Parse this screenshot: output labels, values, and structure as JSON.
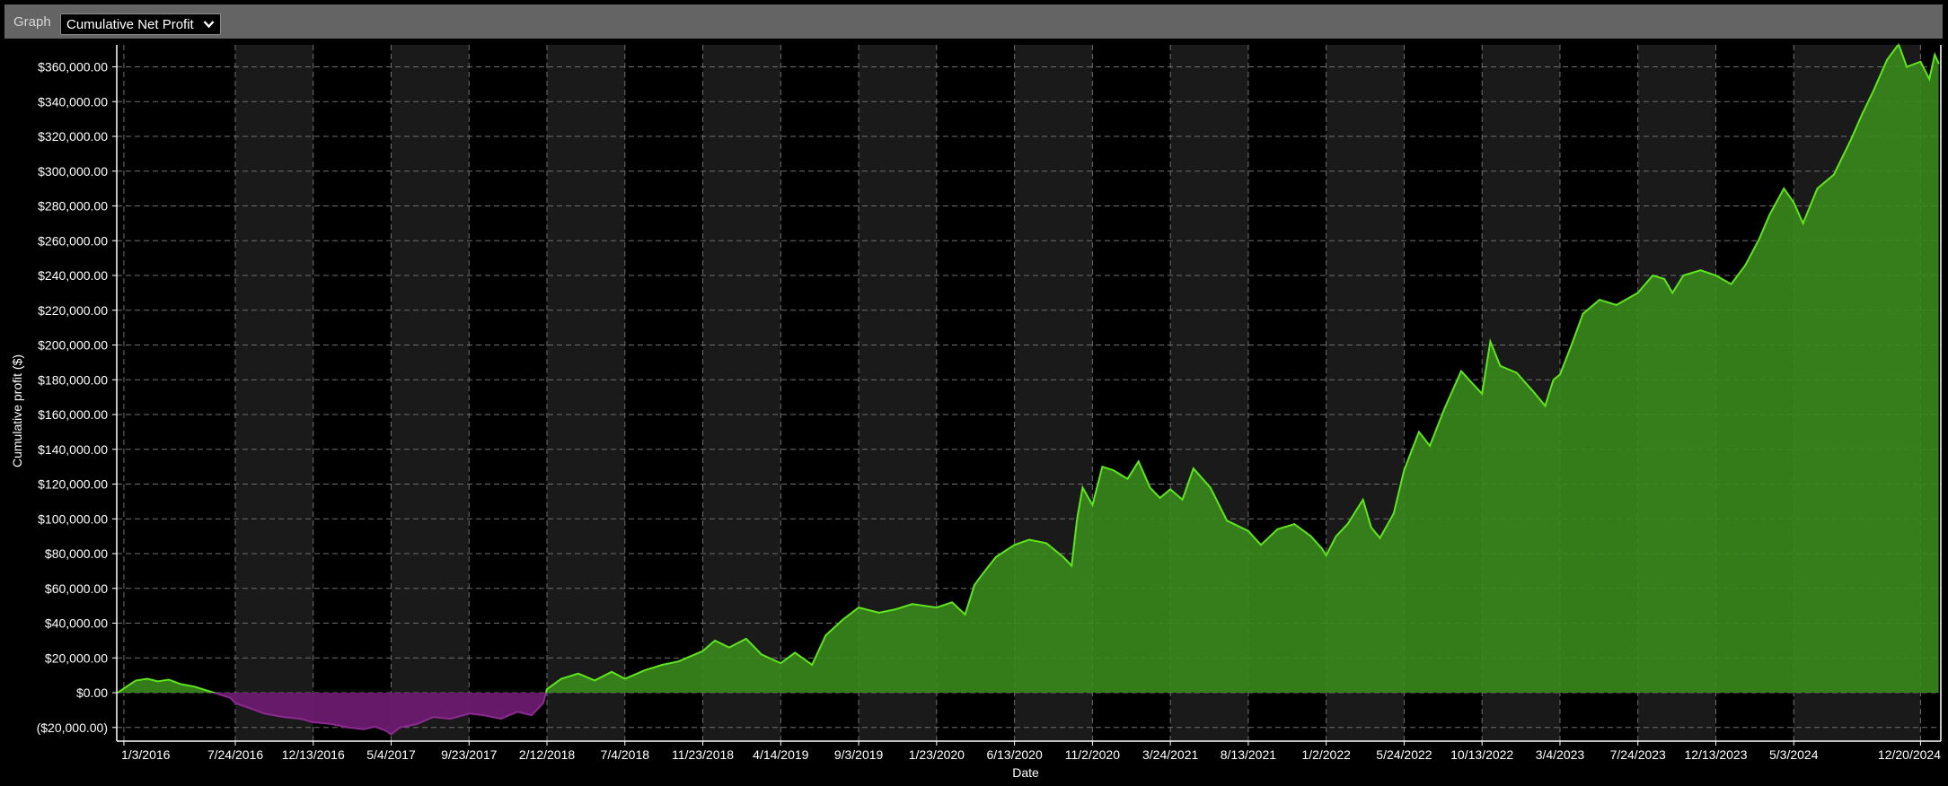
{
  "toolbar": {
    "graph_label": "Graph",
    "graph_select_value": "Cumulative Net Profit",
    "chevron_icon": "chevron-down-icon"
  },
  "colors": {
    "page_background": "#000000",
    "toolbar_background": "#646464",
    "band_dark": "#1a1a1a",
    "grid": "#6e6e6e",
    "profit_fill": "#3a8a1c",
    "profit_line": "#5fe61e",
    "loss_fill": "#6a1a6e",
    "loss_line": "#8b2a8f"
  },
  "chart_data": {
    "type": "area",
    "title": "",
    "xlabel": "Date",
    "ylabel": "Cumulative profit ($)",
    "ylim": [
      -20000,
      360000
    ],
    "xlim": [
      "2015-12-21",
      "2025-01-26"
    ],
    "grid": true,
    "yticks": [
      360000,
      340000,
      320000,
      300000,
      280000,
      260000,
      240000,
      220000,
      200000,
      180000,
      160000,
      140000,
      120000,
      100000,
      80000,
      60000,
      40000,
      20000,
      0,
      -20000
    ],
    "ytick_labels": [
      "$360,000.00",
      "$340,000.00",
      "$320,000.00",
      "$300,000.00",
      "$280,000.00",
      "$260,000.00",
      "$240,000.00",
      "$220,000.00",
      "$200,000.00",
      "$180,000.00",
      "$160,000.00",
      "$140,000.00",
      "$120,000.00",
      "$100,000.00",
      "$80,000.00",
      "$60,000.00",
      "$40,000.00",
      "$20,000.00",
      "$0.00",
      "($20,000.00)"
    ],
    "xticks": [
      "2016-01-03",
      "2016-07-24",
      "2016-12-13",
      "2017-05-04",
      "2017-09-23",
      "2018-02-12",
      "2018-07-04",
      "2018-11-23",
      "2019-04-14",
      "2019-09-03",
      "2020-01-23",
      "2020-06-13",
      "2020-11-02",
      "2021-03-24",
      "2021-08-13",
      "2022-01-02",
      "2022-05-24",
      "2022-10-13",
      "2023-03-04",
      "2023-07-24",
      "2023-12-13",
      "2024-05-03",
      "2024-12-20"
    ],
    "xtick_labels": [
      "1/3/2016",
      "7/24/2016",
      "12/13/2016",
      "5/4/2017",
      "9/23/2017",
      "2/12/2018",
      "7/4/2018",
      "11/23/2018",
      "4/14/2019",
      "9/3/2019",
      "1/23/2020",
      "6/13/2020",
      "11/2/2020",
      "3/24/2021",
      "8/13/2021",
      "1/2/2022",
      "5/24/2022",
      "10/13/2022",
      "3/4/2023",
      "7/24/2023",
      "12/13/2023",
      "5/3/2024",
      "12/20/2024"
    ],
    "series": [
      {
        "values": [
          [
            "2015-12-23",
            0
          ],
          [
            "2016-01-10",
            4000
          ],
          [
            "2016-01-25",
            7000
          ],
          [
            "2016-02-15",
            8000
          ],
          [
            "2016-03-05",
            6500
          ],
          [
            "2016-03-25",
            7500
          ],
          [
            "2016-04-15",
            5000
          ],
          [
            "2016-05-10",
            3500
          ],
          [
            "2016-06-05",
            1000
          ],
          [
            "2016-06-25",
            -1000
          ],
          [
            "2016-07-15",
            -3000
          ],
          [
            "2016-07-24",
            -6000
          ],
          [
            "2016-08-20",
            -9000
          ],
          [
            "2016-09-15",
            -12000
          ],
          [
            "2016-10-20",
            -14000
          ],
          [
            "2016-11-20",
            -15000
          ],
          [
            "2016-12-13",
            -17000
          ],
          [
            "2017-01-15",
            -18000
          ],
          [
            "2017-02-15",
            -20000
          ],
          [
            "2017-03-15",
            -21000
          ],
          [
            "2017-04-05",
            -19500
          ],
          [
            "2017-04-25",
            -22000
          ],
          [
            "2017-05-04",
            -24000
          ],
          [
            "2017-05-20",
            -20000
          ],
          [
            "2017-06-20",
            -18000
          ],
          [
            "2017-07-20",
            -14000
          ],
          [
            "2017-08-20",
            -15000
          ],
          [
            "2017-09-23",
            -12000
          ],
          [
            "2017-10-20",
            -13000
          ],
          [
            "2017-11-20",
            -15000
          ],
          [
            "2017-12-20",
            -11000
          ],
          [
            "2018-01-15",
            -13000
          ],
          [
            "2018-02-05",
            -6000
          ],
          [
            "2018-02-12",
            2000
          ],
          [
            "2018-03-10",
            8000
          ],
          [
            "2018-04-10",
            11000
          ],
          [
            "2018-05-10",
            7000
          ],
          [
            "2018-06-10",
            12000
          ],
          [
            "2018-07-04",
            8000
          ],
          [
            "2018-08-10",
            13000
          ],
          [
            "2018-09-10",
            16000
          ],
          [
            "2018-10-10",
            18000
          ],
          [
            "2018-11-23",
            24000
          ],
          [
            "2018-12-15",
            30000
          ],
          [
            "2019-01-10",
            26000
          ],
          [
            "2019-02-10",
            31000
          ],
          [
            "2019-03-10",
            22000
          ],
          [
            "2019-04-14",
            17000
          ],
          [
            "2019-05-10",
            23000
          ],
          [
            "2019-06-10",
            16000
          ],
          [
            "2019-07-05",
            33000
          ],
          [
            "2019-08-05",
            42000
          ],
          [
            "2019-09-03",
            49000
          ],
          [
            "2019-10-10",
            46000
          ],
          [
            "2019-11-10",
            48000
          ],
          [
            "2019-12-10",
            51000
          ],
          [
            "2020-01-23",
            49000
          ],
          [
            "2020-02-20",
            52000
          ],
          [
            "2020-03-15",
            45000
          ],
          [
            "2020-04-01",
            62000
          ],
          [
            "2020-04-15",
            68000
          ],
          [
            "2020-05-10",
            78000
          ],
          [
            "2020-06-13",
            85000
          ],
          [
            "2020-07-10",
            88000
          ],
          [
            "2020-08-10",
            86000
          ],
          [
            "2020-09-10",
            78000
          ],
          [
            "2020-09-25",
            73000
          ],
          [
            "2020-10-05",
            100000
          ],
          [
            "2020-10-15",
            118000
          ],
          [
            "2020-11-02",
            108000
          ],
          [
            "2020-11-20",
            130000
          ],
          [
            "2020-12-10",
            128000
          ],
          [
            "2021-01-05",
            123000
          ],
          [
            "2021-01-25",
            133000
          ],
          [
            "2021-02-15",
            118000
          ],
          [
            "2021-03-05",
            112000
          ],
          [
            "2021-03-24",
            117000
          ],
          [
            "2021-04-15",
            111000
          ],
          [
            "2021-05-05",
            129000
          ],
          [
            "2021-06-05",
            118000
          ],
          [
            "2021-07-05",
            99000
          ],
          [
            "2021-08-13",
            93000
          ],
          [
            "2021-09-05",
            85000
          ],
          [
            "2021-10-05",
            94000
          ],
          [
            "2021-11-05",
            97000
          ],
          [
            "2021-12-05",
            90000
          ],
          [
            "2021-12-25",
            83000
          ],
          [
            "2022-01-02",
            79000
          ],
          [
            "2022-01-20",
            90000
          ],
          [
            "2022-02-10",
            97000
          ],
          [
            "2022-03-10",
            111000
          ],
          [
            "2022-03-25",
            95000
          ],
          [
            "2022-04-10",
            89000
          ],
          [
            "2022-05-05",
            103000
          ],
          [
            "2022-05-24",
            128000
          ],
          [
            "2022-06-20",
            150000
          ],
          [
            "2022-07-10",
            142000
          ],
          [
            "2022-08-05",
            163000
          ],
          [
            "2022-09-05",
            185000
          ],
          [
            "2022-09-25",
            178000
          ],
          [
            "2022-10-13",
            172000
          ],
          [
            "2022-10-28",
            202000
          ],
          [
            "2022-11-15",
            188000
          ],
          [
            "2022-12-15",
            184000
          ],
          [
            "2023-01-15",
            173000
          ],
          [
            "2023-02-05",
            165000
          ],
          [
            "2023-02-20",
            180000
          ],
          [
            "2023-03-04",
            183000
          ],
          [
            "2023-03-25",
            200000
          ],
          [
            "2023-04-15",
            218000
          ],
          [
            "2023-05-15",
            226000
          ],
          [
            "2023-06-15",
            223000
          ],
          [
            "2023-07-24",
            230000
          ],
          [
            "2023-08-20",
            240000
          ],
          [
            "2023-09-10",
            238000
          ],
          [
            "2023-09-25",
            230000
          ],
          [
            "2023-10-15",
            240000
          ],
          [
            "2023-11-15",
            243000
          ],
          [
            "2023-12-13",
            240000
          ],
          [
            "2024-01-10",
            235000
          ],
          [
            "2024-02-05",
            246000
          ],
          [
            "2024-03-01",
            261000
          ],
          [
            "2024-03-20",
            275000
          ],
          [
            "2024-04-15",
            290000
          ],
          [
            "2024-05-03",
            282000
          ],
          [
            "2024-05-20",
            270000
          ],
          [
            "2024-06-15",
            290000
          ],
          [
            "2024-07-15",
            298000
          ],
          [
            "2024-08-15",
            318000
          ],
          [
            "2024-09-05",
            333000
          ],
          [
            "2024-09-25",
            346000
          ],
          [
            "2024-10-20",
            364000
          ],
          [
            "2024-11-10",
            373000
          ],
          [
            "2024-11-25",
            360000
          ],
          [
            "2024-12-20",
            363000
          ],
          [
            "2025-01-05",
            353000
          ],
          [
            "2025-01-15",
            367000
          ],
          [
            "2025-01-22",
            362000
          ]
        ]
      }
    ]
  }
}
